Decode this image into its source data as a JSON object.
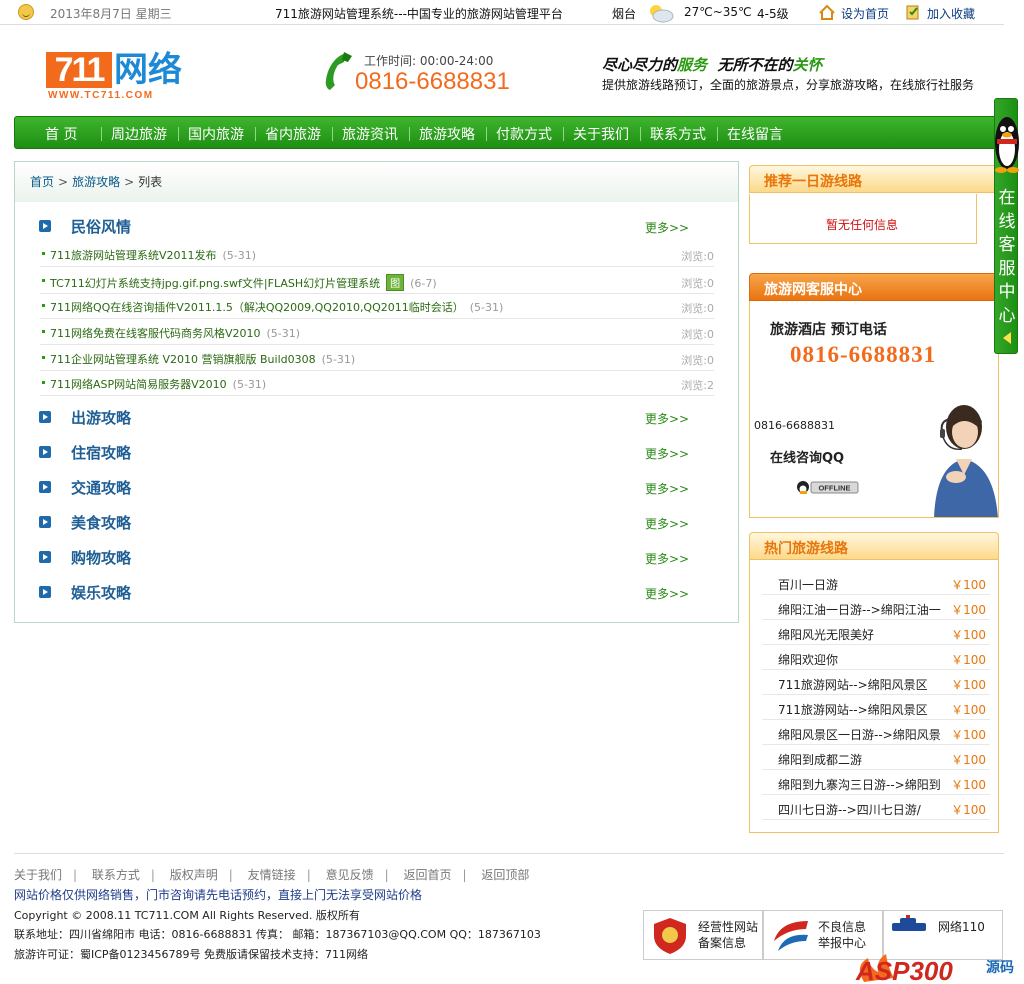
{
  "topbar": {
    "date": "2013年8月7日  星期三",
    "slogan": "711旅游网站管理系统---中国专业的旅游网站管理平台",
    "city": "烟台",
    "temp": "27℃~35℃",
    "wind": "4-5级",
    "set_home": "设为首页",
    "add_fav": "加入收藏"
  },
  "header": {
    "logo_mark": "711",
    "logo_name": "网络",
    "logo_url": "WWW.TC711.COM",
    "worktime_label": "工作时间:",
    "worktime": "00:00-24:00",
    "hotline": "0816-6688831",
    "tagline1_a": "尽心尽力的",
    "tagline1_b": "服务",
    "tagline1_c": "  无所不在的",
    "tagline1_d": "关怀",
    "tagline2": "提供旅游线路预订，全面的旅游景点，分享旅游攻略，在线旅行社服务"
  },
  "nav": [
    "首 页",
    "周边旅游",
    "国内旅游",
    "省内旅游",
    "旅游资讯",
    "旅游攻略",
    "付款方式",
    "关于我们",
    "联系方式",
    "在线留言"
  ],
  "breadcrumb": {
    "home": "首页",
    "section": "旅游攻略",
    "current": "列表"
  },
  "more_label": "更多>>",
  "categories": [
    {
      "title": "民俗风情"
    },
    {
      "title": "出游攻略"
    },
    {
      "title": "住宿攻略"
    },
    {
      "title": "交通攻略"
    },
    {
      "title": "美食攻略"
    },
    {
      "title": "购物攻略"
    },
    {
      "title": "娱乐攻略"
    }
  ],
  "articles": [
    {
      "title": "711旅游网站管理系统V2011发布",
      "date": "(5-31)",
      "views": "浏览:0",
      "pic": ""
    },
    {
      "title": "TC711幻灯片系统支持jpg.gif.png.swf文件|FLASH幻灯片管理系统",
      "date": "(6-7)",
      "views": "浏览:0",
      "pic": "图"
    },
    {
      "title": "711网络QQ在线咨询插件V2011.1.5（解决QQ2009,QQ2010,QQ2011临时会话）",
      "date": "(5-31)",
      "views": "浏览:0",
      "pic": ""
    },
    {
      "title": "711网络免费在线客服代码商务风格V2010",
      "date": "(5-31)",
      "views": "浏览:0",
      "pic": ""
    },
    {
      "title": "711企业网站管理系统 V2010 营销旗舰版 Build0308",
      "date": "(5-31)",
      "views": "浏览:0",
      "pic": ""
    },
    {
      "title": "711网络ASP网站简易服务器V2010",
      "date": "(5-31)",
      "views": "浏览:2",
      "pic": ""
    }
  ],
  "recommend": {
    "title": "推荐一日游线路",
    "empty": "暂无任何信息"
  },
  "service": {
    "title": "旅游网客服中心",
    "line1": "旅游酒店  预订电话",
    "phone": "0816-6688831",
    "small_phone": "0816-6688831",
    "qq_label": "在线咨询QQ",
    "qq_status": "OFFLINE"
  },
  "hot": {
    "title": "热门旅游线路",
    "items": [
      {
        "name": "百川一日游",
        "price": "￥100"
      },
      {
        "name": "绵阳江油一日游-->绵阳江油一",
        "price": "￥100"
      },
      {
        "name": "绵阳风光无限美好",
        "price": "￥100"
      },
      {
        "name": "绵阳欢迎你",
        "price": "￥100"
      },
      {
        "name": "711旅游网站-->绵阳风景区",
        "price": "￥100"
      },
      {
        "name": "711旅游网站-->绵阳风景区",
        "price": "￥100"
      },
      {
        "name": "绵阳风景区一日游-->绵阳风景",
        "price": "￥100"
      },
      {
        "name": "绵阳到成都二游",
        "price": "￥100"
      },
      {
        "name": "绵阳到九寨沟三日游-->绵阳到",
        "price": "￥100"
      },
      {
        "name": "四川七日游-->四川七日游/",
        "price": "￥100"
      }
    ]
  },
  "qqtab": {
    "text": "在线客服中心"
  },
  "footer": {
    "links": [
      "关于我们",
      "联系方式",
      "版权声明",
      "友情链接",
      "意见反馈",
      "返回首页",
      "返回顶部"
    ],
    "note": "网站价格仅供网络销售，门市咨询请先电话预约，直接上门无法享受网站价格",
    "copyright": "Copyright © 2008.11 TC711.COM  All Rights Reserved.  版权所有",
    "contact": "联系地址：四川省绵阳市  电话：0816-6688831  传真：  邮箱：187367103@QQ.COM  QQ：187367103",
    "license": "旅游许可证：蜀ICP备0123456789号 免费版请保留技术支持：711网络",
    "badge1": "经营性网站\n备案信息",
    "badge2": "不良信息\n举报中心",
    "badge3": "网络110",
    "asp_logo": "ASP300",
    "asp_logo_suffix": "源码"
  },
  "colors": {
    "nav_green": "#1d8f12",
    "orange": "#f26b1d",
    "link_blue": "#1f5f95",
    "price": "#e8760a"
  }
}
